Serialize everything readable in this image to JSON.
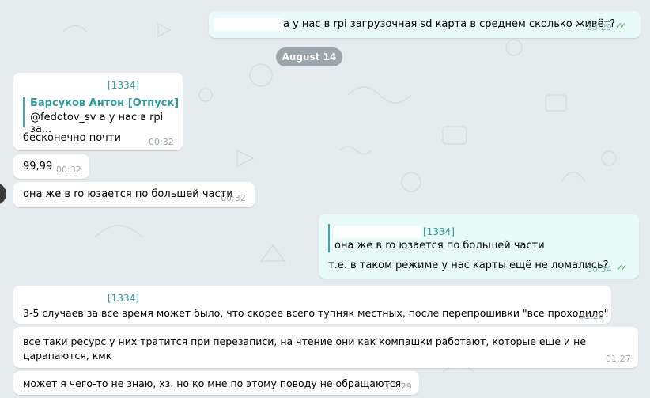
{
  "colors": {
    "background": "#e6ebee",
    "incoming_bubble": "#ffffff",
    "outgoing_bubble": "#e8fbf9",
    "accent": "#2e9aa0",
    "read_checks": "#4fae4e"
  },
  "messages": [
    {
      "text": "а у нас в rpi загрузочная sd карта в среднем сколько живёт?",
      "time": "23:29"
    },
    {
      "sender": "[1334]",
      "reply_name": "Барсуков Антон [Отпуск]",
      "reply_text": "@fedotov_sv а у нас в rpi за...",
      "text": "бесконечно почти",
      "time": "00:32"
    },
    {
      "text": "99,99",
      "time": "00:32"
    },
    {
      "text": "она же в ro юзается по большей части",
      "time": "00:32"
    },
    {
      "sender": "[1334]",
      "reply_text": "она же в ro юзается по большей части",
      "text": "т.е. в таком режиме у нас карты ещё не ломались?",
      "time": "00:34"
    },
    {
      "sender": "[1334]",
      "text": "3-5 случаев за все время может было, что скорее всего тупняк местных, после перепрошивки \"все проходило\"",
      "time": "01:26"
    },
    {
      "text": "все таки ресурс у них тратится при перезаписи, на чтение они как компашки работают, которые еще и не царапаются, кмк",
      "time": "01:27"
    },
    {
      "text": "может я чего-то не знаю, хз. но ко мне по этому поводу не обращаются",
      "time": "01:29"
    }
  ],
  "date_separator": "August 14",
  "icons": {
    "read_receipt": "double-check-icon"
  }
}
